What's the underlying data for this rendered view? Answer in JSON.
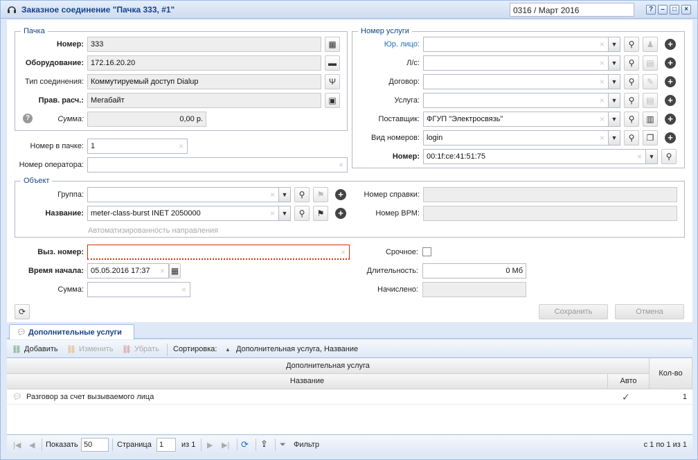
{
  "window": {
    "title": "Заказное соединение \"Пачка 333, #1\"",
    "period": "0316 / Март 2016",
    "help": "?",
    "min": "–",
    "max": "□",
    "close": "×"
  },
  "pack": {
    "legend": "Пачка",
    "number_label": "Номер:",
    "number": "333",
    "equipment_label": "Оборудование:",
    "equipment": "172.16.20.20",
    "conn_type_label": "Тип соединения:",
    "conn_type": "Коммутируемый доступ Dialup",
    "calc_rule_label": "Прав. расч.:",
    "calc_rule": "Мегабайт",
    "sum_label": "Сумма:",
    "sum": "0,00 р."
  },
  "in_pack_label": "Номер в пачке:",
  "in_pack": "1",
  "operator_num_label": "Номер оператора:",
  "operator_num": "",
  "service": {
    "legend": "Номер услуги",
    "legal_label": "Юр. лицо:",
    "legal": "",
    "account_label": "Л/с:",
    "account": "",
    "contract_label": "Договор:",
    "contract": "",
    "service_label": "Услуга:",
    "service": "",
    "provider_label": "Поставщик:",
    "provider": "ФГУП \"Электросвязь\"",
    "numtype_label": "Вид номеров:",
    "numtype": "login",
    "number_label": "Номер:",
    "number": "00:1f:ce:41:51:75"
  },
  "object": {
    "legend": "Объект",
    "group_label": "Группа:",
    "group": "",
    "name_label": "Название:",
    "name": "meter-class-burst INET 2050000",
    "auto_dir": "Автоматизированность направления",
    "cert_label": "Номер справки:",
    "cert": "",
    "vrm_label": "Номер ВРМ:",
    "vrm": ""
  },
  "call": {
    "called_label": "Выз. номер:",
    "called": "",
    "start_label": "Время начала:",
    "start": "05.05.2016 17:37",
    "sum_label": "Сумма:",
    "sum": "",
    "urgent_label": "Срочное:",
    "duration_label": "Длительность:",
    "duration": "0 Мб",
    "charged_label": "Начислено:",
    "charged": ""
  },
  "buttons": {
    "save": "Сохранить",
    "cancel": "Отмена"
  },
  "tab": {
    "label": "Дополнительные услуги"
  },
  "toolbar": {
    "add": "Добавить",
    "edit": "Изменить",
    "remove": "Убрать",
    "sort_label": "Сортировка:",
    "sort_value": "Дополнительная услуга, Название"
  },
  "grid": {
    "group_header": "Дополнительная услуга",
    "col_name": "Название",
    "col_auto": "Авто",
    "col_qty": "Кол-во",
    "rows": [
      {
        "name": "Разговор за счет вызываемого лица",
        "auto": "✓",
        "qty": "1"
      }
    ]
  },
  "pager": {
    "show_label": "Показать",
    "page_size": "50",
    "page_label": "Страница",
    "page": "1",
    "of": "из 1",
    "filter": "Фильтр",
    "summary": "с 1 по 1 из 1"
  }
}
